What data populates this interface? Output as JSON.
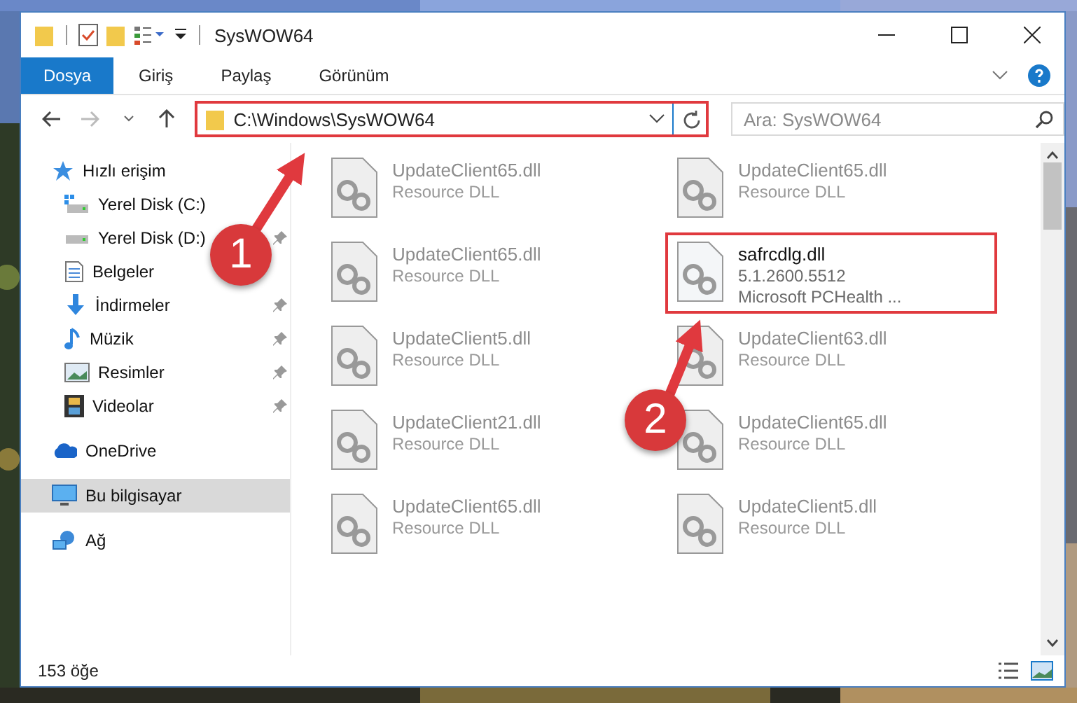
{
  "window": {
    "title": "SysWOW64"
  },
  "ribbon_tabs": [
    {
      "label": "Dosya",
      "selected": true
    },
    {
      "label": "Giriş",
      "selected": false
    },
    {
      "label": "Paylaş",
      "selected": false
    },
    {
      "label": "Görünüm",
      "selected": false
    }
  ],
  "address": {
    "path": "C:\\Windows\\SysWOW64",
    "highlighted": true
  },
  "search": {
    "placeholder": "Ara: SysWOW64"
  },
  "sidebar": {
    "items": [
      {
        "label": "Hızlı erişim",
        "kind": "star",
        "pinned": false,
        "selected": false,
        "group": true
      },
      {
        "label": "Yerel Disk (C:)",
        "kind": "windows-drive",
        "pinned": false,
        "selected": false,
        "group": false
      },
      {
        "label": "Yerel Disk (D:)",
        "kind": "drive",
        "pinned": true,
        "selected": false,
        "group": false
      },
      {
        "label": "Belgeler",
        "kind": "document",
        "pinned": false,
        "selected": false,
        "group": false
      },
      {
        "label": "İndirmeler",
        "kind": "download",
        "pinned": true,
        "selected": false,
        "group": false
      },
      {
        "label": "Müzik",
        "kind": "music",
        "pinned": true,
        "selected": false,
        "group": false
      },
      {
        "label": "Resimler",
        "pinned": true,
        "selected": false,
        "group": false
      },
      {
        "label": "Videolar",
        "kind": "film",
        "pinned": true,
        "selected": false,
        "group": false
      },
      {
        "label": "OneDrive",
        "kind": "cloud",
        "pinned": false,
        "selected": false,
        "group": true
      },
      {
        "label": "Bu bilgisayar",
        "kind": "monitor",
        "pinned": false,
        "selected": true,
        "group": true
      },
      {
        "label": "Ağ",
        "kind": "network",
        "pinned": false,
        "selected": false,
        "group": true
      }
    ]
  },
  "files": [
    {
      "name": "UpdateClient65.dll",
      "lines": [
        "Resource DLL"
      ],
      "blurred": true,
      "highlighted": false
    },
    {
      "name": "UpdateClient65.dll",
      "lines": [
        "Resource DLL"
      ],
      "blurred": true,
      "highlighted": false
    },
    {
      "name": "UpdateClient65.dll",
      "lines": [
        "Resource DLL"
      ],
      "blurred": true,
      "highlighted": false
    },
    {
      "name": "safrcdlg.dll",
      "lines": [
        "5.1.2600.5512",
        "Microsoft PCHealth ..."
      ],
      "blurred": false,
      "highlighted": true
    },
    {
      "name": "UpdateClient5.dll",
      "lines": [
        "Resource DLL"
      ],
      "blurred": true,
      "highlighted": false
    },
    {
      "name": "UpdateClient63.dll",
      "lines": [
        "Resource DLL"
      ],
      "blurred": true,
      "highlighted": false
    },
    {
      "name": "UpdateClient21.dll",
      "lines": [
        "Resource DLL"
      ],
      "blurred": true,
      "highlighted": false
    },
    {
      "name": "UpdateClient65.dll",
      "lines": [
        "Resource DLL"
      ],
      "blurred": true,
      "highlighted": false
    },
    {
      "name": "UpdateClient65.dll",
      "lines": [
        "Resource DLL"
      ],
      "blurred": true,
      "highlighted": false
    },
    {
      "name": "UpdateClient5.dll",
      "lines": [
        "Resource DLL"
      ],
      "blurred": true,
      "highlighted": false
    }
  ],
  "status_bar": {
    "count": "153 öğe"
  },
  "callouts": [
    {
      "number": "1"
    },
    {
      "number": "2"
    }
  ]
}
